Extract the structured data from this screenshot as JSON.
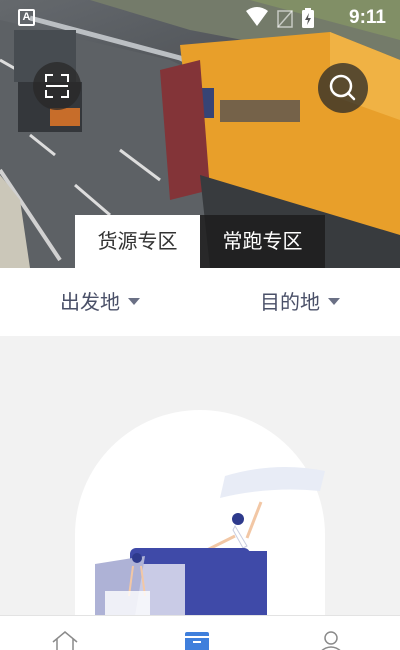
{
  "status_bar": {
    "time": "9:11",
    "app_badge": "A"
  },
  "icons": {
    "scan": "scan-icon",
    "search": "search-icon",
    "home": "home-icon",
    "goods": "box-icon",
    "profile": "person-icon"
  },
  "tabs": [
    {
      "label": "货源专区",
      "active": true
    },
    {
      "label": "常跑专区",
      "active": false
    }
  ],
  "filters": {
    "origin": "出发地",
    "destination": "目的地"
  },
  "colors": {
    "filter_text": "#4a5068",
    "illustration_blue": "#3f4aa8",
    "truck_orange": "#e79a1f"
  }
}
